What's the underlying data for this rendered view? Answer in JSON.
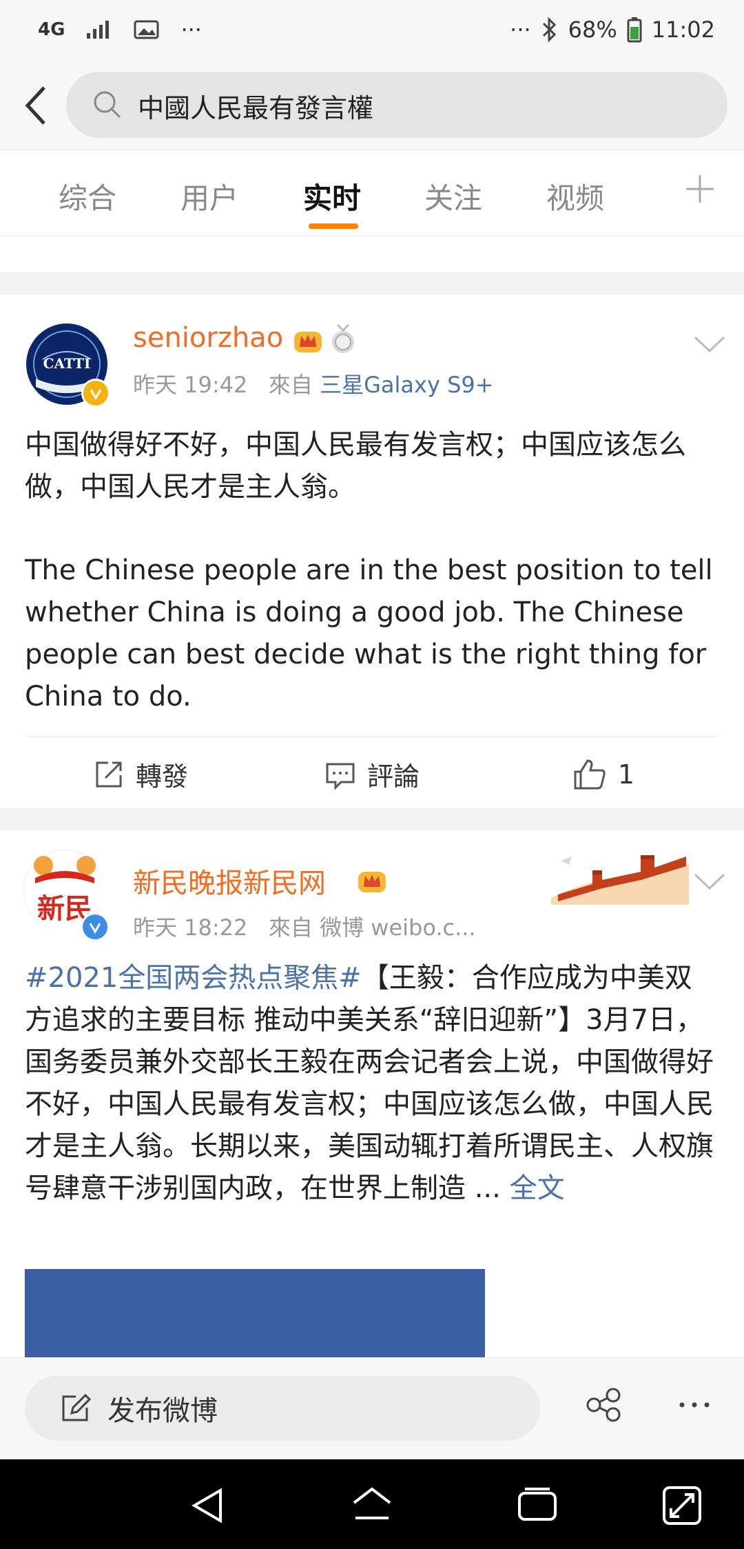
{
  "status_bar": {
    "network": "4G",
    "more": "···",
    "right_more": "···",
    "battery": "68%",
    "time": "11:02"
  },
  "search": {
    "query": "中國人民最有發言權"
  },
  "tabs": [
    {
      "label": "综合"
    },
    {
      "label": "用户"
    },
    {
      "label": "实时"
    },
    {
      "label": "关注"
    },
    {
      "label": "视频"
    }
  ],
  "posts": [
    {
      "avatar_text": "CATTI",
      "user": "seniorzhao",
      "time": "昨天 19:42",
      "from_label": "來自",
      "source": "三星Galaxy S9+",
      "text_cn": "中国做得好不好，中国人民最有发言权；中国应该怎么做，中国人民才是主人翁。",
      "text_en": "The Chinese people are in the best position to tell whether China is doing a good job. The Chinese people can best decide what is the right thing for China to do.",
      "repost_label": "轉發",
      "comment_label": "評論",
      "like_count": "1"
    },
    {
      "avatar_text": "新民",
      "user": "新民晚报新民网",
      "time": "昨天 18:22",
      "from_label": "來自",
      "source": "微博 weibo.c...",
      "topic": "#2021全国两会热点聚焦#",
      "text": "【王毅：合作应成为中美双方追求的主要目标 推动中美关系“辞旧迎新”】3月7日，国务委员兼外交部长王毅在两会记者会上说，中国做得好不好，中国人民最有发言权；中国应该怎么做，中国人民才是主人翁。长期以来，美国动辄打着所谓民主、人权旗号肆意干涉别国内政，在世界上制造 ...",
      "more_label": "全文"
    }
  ],
  "compose": {
    "label": "发布微博"
  },
  "colors": {
    "accent": "#ff8200",
    "username": "#f26c22",
    "link": "#4a72a8",
    "image_block": "#3c5fa3"
  }
}
